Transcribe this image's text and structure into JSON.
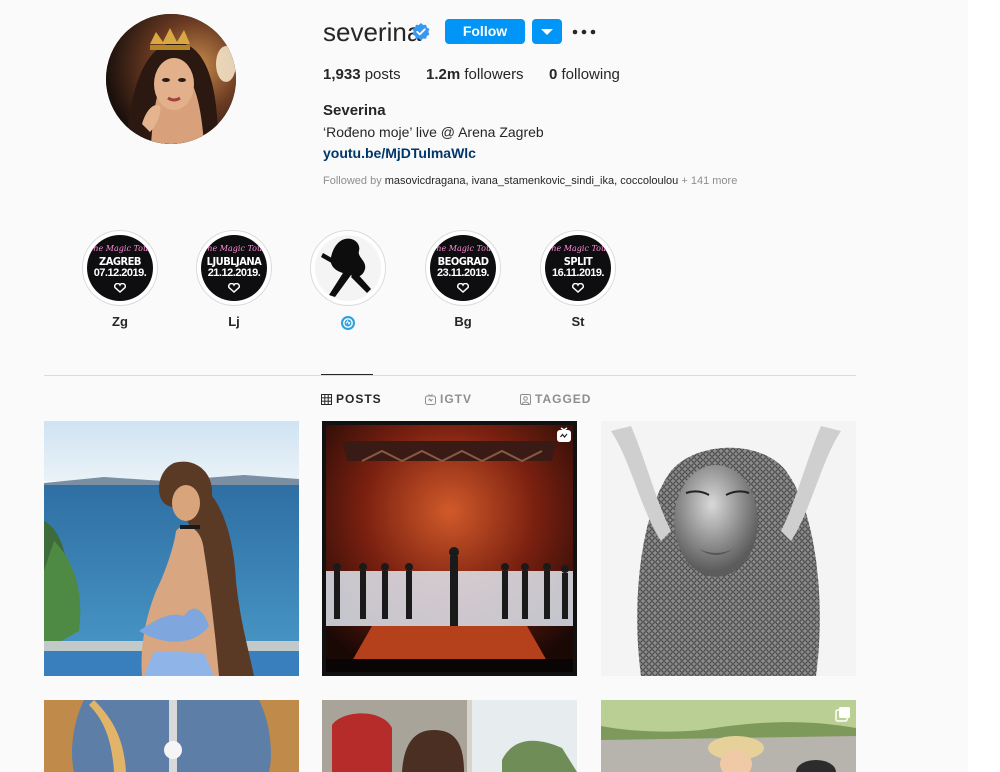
{
  "profile": {
    "username": "severina",
    "follow_label": "Follow",
    "posts_count": "1,933",
    "posts_label": "posts",
    "followers_count": "1.2m",
    "followers_label": "followers",
    "following_count": "0",
    "following_label": "following",
    "full_name": "Severina",
    "bio": "‘Rođeno moje’ live @ Arena Zagreb",
    "link": "youtu.be/MjDTulmaWlc",
    "followed_by_prefix": "Followed by",
    "followed_by": [
      "masovicdragana",
      "ivana_stamenkovic_sindi_ika",
      "coccoloulou"
    ],
    "followed_by_more": "+ 141 more"
  },
  "colors": {
    "accent": "#0095f6",
    "link": "#00376b",
    "muted": "#8e8e8e",
    "verified": "#3897f0"
  },
  "highlights": [
    {
      "label": "Zg",
      "tour": "The Magic Tour",
      "city": "ZAGREB",
      "date": "07.12.2019."
    },
    {
      "label": "Lj",
      "tour": "The Magic Tour",
      "city": "LJUBLJANA",
      "date": "21.12.2019."
    },
    {
      "label": "",
      "badge_icon": "badge-icon"
    },
    {
      "label": "Bg",
      "tour": "The Magic Tour",
      "city": "BEOGRAD",
      "date": "23.11.2019."
    },
    {
      "label": "St",
      "tour": "The Magic Tour",
      "city": "SPLIT",
      "date": "16.11.2019."
    }
  ],
  "tabs": [
    {
      "label": "POSTS",
      "icon": "grid-icon",
      "active": true
    },
    {
      "label": "IGTV",
      "icon": "igtv-icon",
      "active": false
    },
    {
      "label": "TAGGED",
      "icon": "tagged-icon",
      "active": false
    }
  ],
  "posts": [
    {
      "id": "post-1",
      "icon": null
    },
    {
      "id": "post-2",
      "icon": "igtv-post-icon"
    },
    {
      "id": "post-3",
      "icon": null
    },
    {
      "id": "post-4",
      "icon": null
    },
    {
      "id": "post-5",
      "icon": null
    },
    {
      "id": "post-6",
      "icon": "carousel-icon"
    }
  ]
}
